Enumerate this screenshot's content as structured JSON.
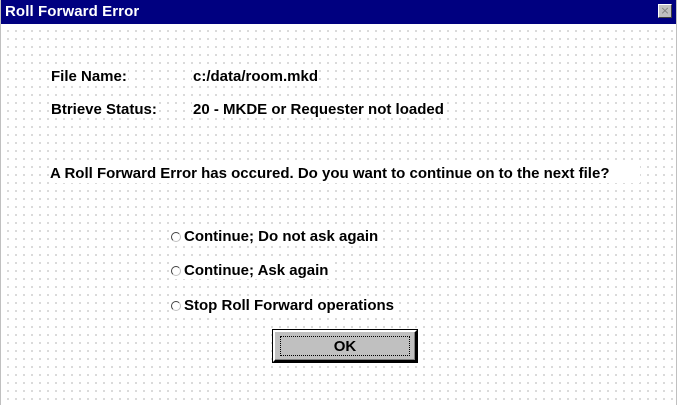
{
  "window": {
    "title": "Roll Forward Error",
    "title_bar_color": "#000080",
    "close_glyph": "×"
  },
  "fields": {
    "file_name_label": "File Name:",
    "file_name_value": "c:/data/room.mkd",
    "btrieve_status_label": "Btrieve Status:",
    "btrieve_status_value": "20 - MKDE or Requester not loaded"
  },
  "message": "A Roll Forward Error has occured.  Do you want to continue on to the next file?",
  "options": [
    {
      "label": "Continue; Do not ask again",
      "selected": false
    },
    {
      "label": "Continue; Ask again",
      "selected": false
    },
    {
      "label": "Stop Roll Forward operations",
      "selected": false
    }
  ],
  "buttons": {
    "ok_label": "OK"
  }
}
